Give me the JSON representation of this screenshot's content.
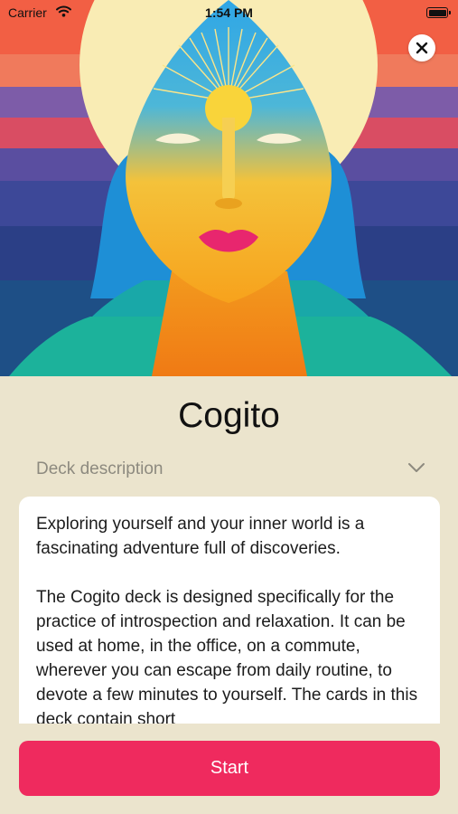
{
  "status_bar": {
    "carrier": "Carrier",
    "time": "1:54 PM"
  },
  "deck": {
    "title": "Cogito"
  },
  "description": {
    "label": "Deck description",
    "paragraphs": [
      "Exploring yourself and your inner world is a fascinating adventure full of discoveries.",
      "The Cogito deck is designed specifically for the practice of introspection and relaxation. It can be used at home, in the office, on a commute, wherever you can escape from daily routine, to devote a few minutes to yourself. The cards in this deck contain short"
    ]
  },
  "actions": {
    "start_label": "Start"
  },
  "colors": {
    "background": "#ebe4cd",
    "accent": "#ef2a5e",
    "card": "#ffffff",
    "muted_text": "#8d8a7f"
  }
}
